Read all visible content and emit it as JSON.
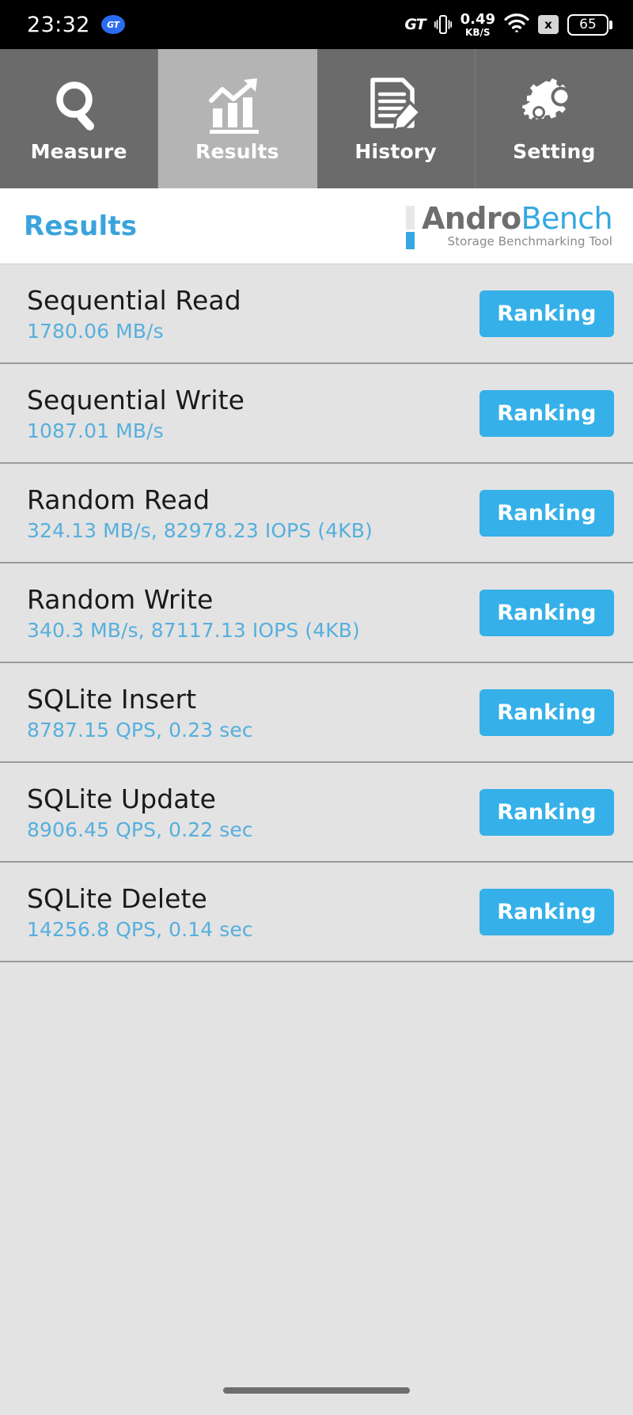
{
  "status_bar": {
    "clock": "23:32",
    "gt_badge_label": "GT",
    "gt_mode_label": "GT",
    "network_speed_value": "0.49",
    "network_speed_unit": "KB/S",
    "sim_label": "x",
    "battery_level": "65"
  },
  "tabs": [
    {
      "label": "Measure",
      "icon": "magnifier-icon",
      "active": false
    },
    {
      "label": "Results",
      "icon": "bar-chart-trend-icon",
      "active": true
    },
    {
      "label": "History",
      "icon": "document-pencil-icon",
      "active": false
    },
    {
      "label": "Setting",
      "icon": "gears-icon",
      "active": false
    }
  ],
  "header": {
    "page_title": "Results",
    "brand_first": "Andro",
    "brand_second": "Bench",
    "brand_tagline": "Storage Benchmarking Tool"
  },
  "results": {
    "ranking_label": "Ranking",
    "rows": [
      {
        "name": "Sequential Read",
        "value": "1780.06 MB/s"
      },
      {
        "name": "Sequential Write",
        "value": "1087.01 MB/s"
      },
      {
        "name": "Random Read",
        "value": "324.13 MB/s, 82978.23 IOPS (4KB)"
      },
      {
        "name": "Random Write",
        "value": "340.3 MB/s, 87117.13 IOPS (4KB)"
      },
      {
        "name": "SQLite Insert",
        "value": "8787.15 QPS, 0.23 sec"
      },
      {
        "name": "SQLite Update",
        "value": "8906.45 QPS, 0.22 sec"
      },
      {
        "name": "SQLite Delete",
        "value": "14256.8 QPS, 0.14 sec"
      }
    ]
  },
  "colors": {
    "accent_blue": "#35b0e8",
    "value_blue": "#56afdd",
    "tab_inactive": "#6b6b6b",
    "tab_active": "#b4b4b4",
    "list_bg": "#e3e3e3"
  },
  "nav_bar": {
    "gesture_pill": "home-indicator"
  }
}
